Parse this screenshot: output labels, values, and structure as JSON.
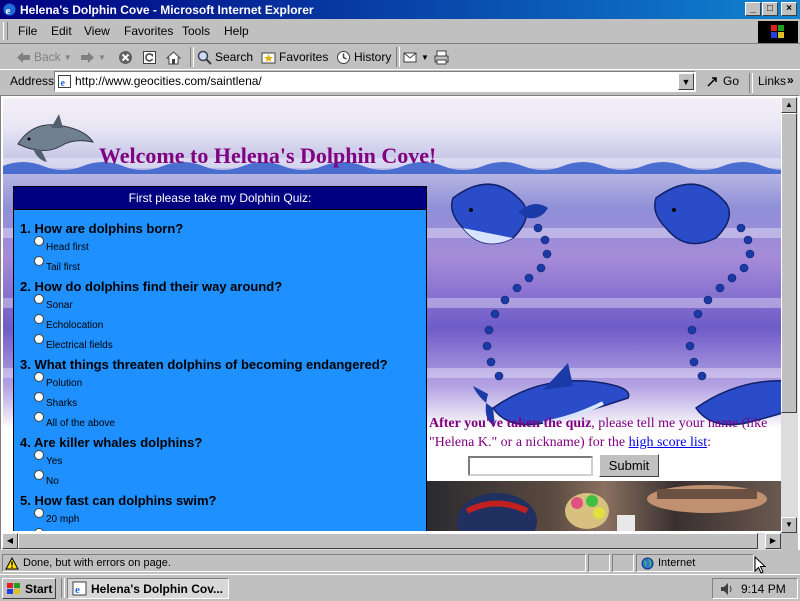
{
  "window": {
    "title": "Helena's Dolphin Cove - Microsoft Internet Explorer",
    "minimize": "_",
    "maximize": "□",
    "close": "×"
  },
  "menu": [
    "File",
    "Edit",
    "View",
    "Favorites",
    "Tools",
    "Help"
  ],
  "toolbar": {
    "back": "Back",
    "search": "Search",
    "favorites": "Favorites",
    "history": "History"
  },
  "address": {
    "label": "Address",
    "url": "http://www.geocities.com/saintlena/",
    "go": "Go",
    "links": "Links"
  },
  "page": {
    "welcome": "Welcome to Helena's Dolphin Cove!",
    "quiz_header": "First please take my Dolphin Quiz:",
    "questions": [
      {
        "text": "1. How are dolphins born?",
        "options": [
          "Head first",
          "Tail first"
        ]
      },
      {
        "text": "2. How do dolphins find their way around?",
        "options": [
          "Sonar",
          "Echolocation",
          "Electrical fields"
        ]
      },
      {
        "text": "3. What things threaten dolphins of becoming endangered?",
        "options": [
          "Polution",
          "Sharks",
          "All of the above"
        ]
      },
      {
        "text": "4. Are killer whales dolphins?",
        "options": [
          "Yes",
          "No"
        ]
      },
      {
        "text": "5. How fast can dolphins swim?",
        "options": [
          "20 mph"
        ]
      }
    ],
    "score_bold": "After you've taken the quiz",
    "score_text_1": ", please tell me your name (like \"Helena K.\" or a nickname) for the ",
    "score_link": "high score list",
    "score_text_2": ":",
    "submit": "Submit"
  },
  "status": {
    "text": "Done, but with errors on page.",
    "zone": "Internet"
  },
  "taskbar": {
    "start": "Start",
    "task": "Helena's Dolphin Cov...",
    "clock": "9:14 PM"
  },
  "colors": {
    "title_bar": "#000080",
    "welcome": "#800080",
    "quiz_panel": "#1e90ff",
    "quiz_header": "#000080",
    "link": "#0000ee"
  }
}
